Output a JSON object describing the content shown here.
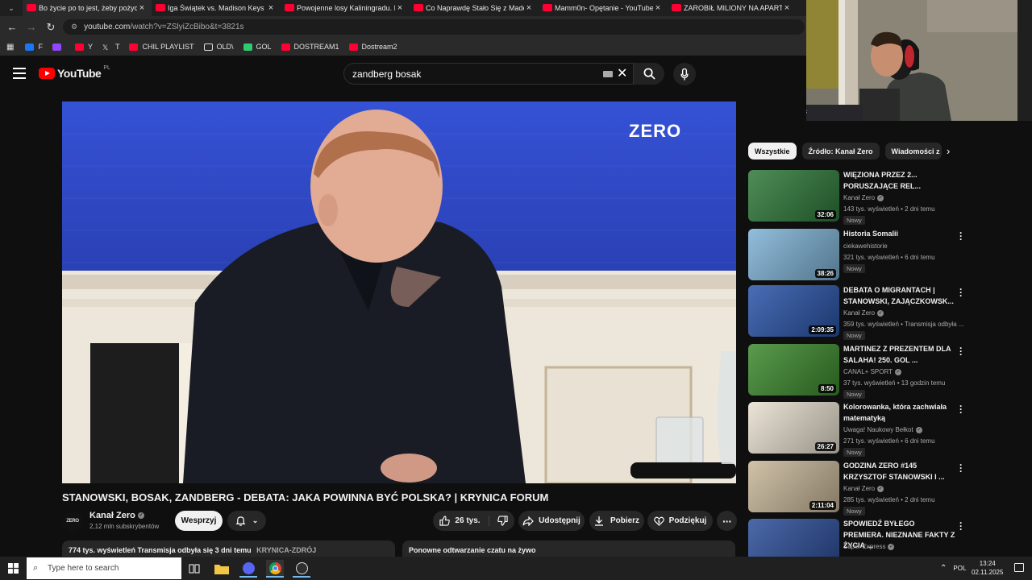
{
  "browser": {
    "tabs": [
      {
        "title": "Bo życie po to jest, żeby pożyczać",
        "active": true
      },
      {
        "title": "Iga Świątek vs. Madison Keys | Skrót"
      },
      {
        "title": "Powojenne losy Kaliningradu. Podróże"
      },
      {
        "title": "Co Naprawdę Stało Się z Madeleine"
      },
      {
        "title": "Mamm0n- Opętanie - YouTube"
      },
      {
        "title": "ZAROBIŁ MILIONY NA APARTAMENTACH"
      }
    ],
    "url_main": "youtube.com",
    "url_path": "/watch?v=ZSlyiZcBibo&t=3821s",
    "bookmarks": [
      "F",
      "",
      "Y",
      "T",
      "CHIL PLAYLIST",
      "OLD\\",
      "GOL",
      "DOSTREAM1",
      "Dostream2"
    ]
  },
  "youtube": {
    "logo_text": "YouTube",
    "region": "PL",
    "search_value": "zandberg bosak",
    "video": {
      "title": "STANOWSKI, BOSAK, ZANDBERG - DEBATA: JAKA POWINNA BYĆ POLSKA? | KRYNICA FORUM",
      "watermark": "ZERO",
      "channel_avatar_text": "ZERO",
      "channel": "Kanał Zero",
      "subscribers": "2,12 mln subskrybentów",
      "support_label": "Wesprzyj",
      "likes": "26 tys.",
      "share_label": "Udostępnij",
      "download_label": "Pobierz",
      "thanks_label": "Podziękuj",
      "views_line": "774 tys. wyświetleń  Transmisja odbyła się 3 dni temu",
      "location": "KRYNICA-ZDRÓJ",
      "chat_replay": "Ponowne odtwarzanie czatu na żywo"
    },
    "chips": [
      "Wszystkie",
      "Źródło: Kanał Zero",
      "Wiadomości z"
    ],
    "recommendations": [
      {
        "title": "WIĘZIONA PRZEZ 2... PORUSZAJĄCE REL...",
        "channel": "Kanał Zero",
        "verified": true,
        "meta": "143 tys. wyświetleń • 2 dni temu",
        "duration": "32:06",
        "badge": "Nowy",
        "thumb_color": "#2f7a3a"
      },
      {
        "title": "Historia Somalii",
        "channel": "ciekawehistorie",
        "verified": false,
        "meta": "321 tys. wyświetleń • 6 dni temu",
        "duration": "38:26",
        "badge": "Nowy",
        "thumb_color": "#7fb3d6"
      },
      {
        "title": "DEBATA O MIGRANTACH | STANOWSKI, ZAJĄCZKOWSK...",
        "channel": "Kanał Zero",
        "verified": true,
        "meta": "359 tys. wyświetleń • Transmisja odbyła ...",
        "duration": "2:09:35",
        "badge": "Nowy",
        "thumb_color": "#2a54a8"
      },
      {
        "title": "MARTINEZ Z PREZENTEM DLA SALAHA! 250. GOL ...",
        "channel": "CANAL+ SPORT",
        "verified": true,
        "meta": "37 tys. wyświetleń • 13 godzin temu",
        "duration": "8:50",
        "badge": "Nowy",
        "thumb_color": "#3d8a2e"
      },
      {
        "title": "Kolorowanka, która zachwiała matematyką",
        "channel": "Uwaga! Naukowy Bełkot",
        "verified": true,
        "meta": "271 tys. wyświetleń • 6 dni temu",
        "duration": "26:27",
        "badge": "Nowy",
        "thumb_color": "#e8e0d0"
      },
      {
        "title": "GODZINA ZERO #145 KRZYSZTOF STANOWSKI I ...",
        "channel": "Kanał Zero",
        "verified": true,
        "meta": "285 tys. wyświetleń • 2 dni temu",
        "duration": "2:11:04",
        "badge": "Nowy",
        "thumb_color": "#c9b89a"
      },
      {
        "title": "SPOWIEDŹ BYŁEGO PREMIERA. NIEZNANE FAKTY Z ŻYCIA ...",
        "channel": "Super Express",
        "verified": true,
        "meta": "",
        "duration": "",
        "badge": "",
        "thumb_color": "#2d4f9a"
      }
    ],
    "cam_partial_label": "Pc"
  },
  "taskbar": {
    "search_placeholder": "Type here to search",
    "lang": "POL",
    "time": "13:24",
    "date": "02.11.2025"
  }
}
